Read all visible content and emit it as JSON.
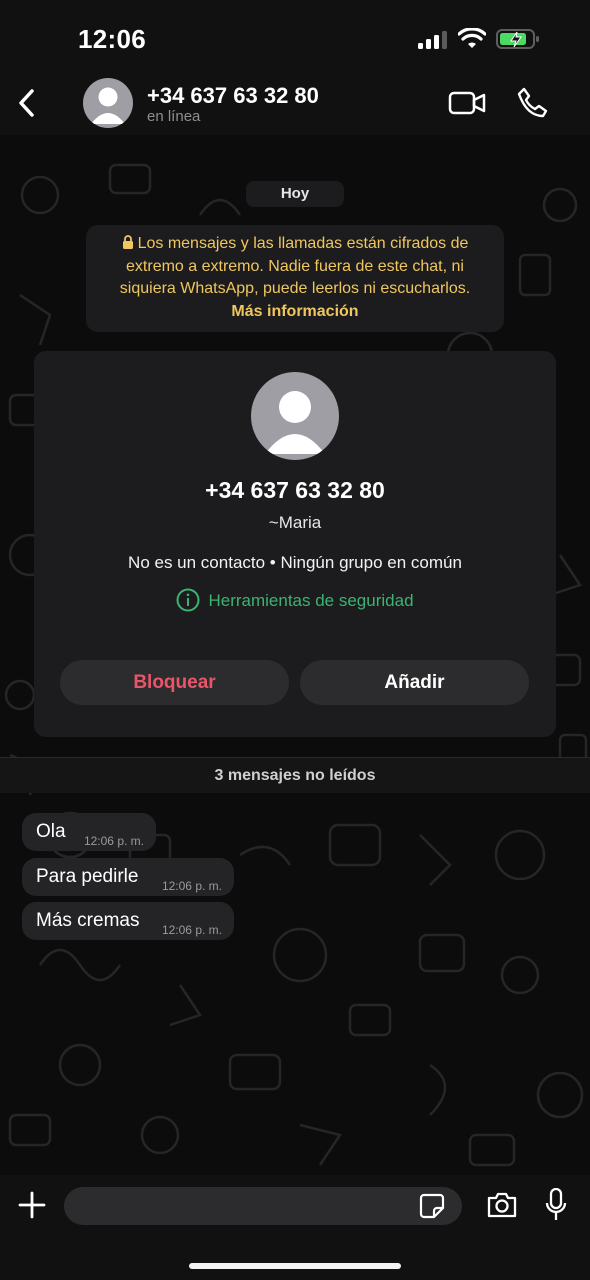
{
  "status_bar": {
    "time": "12:06"
  },
  "header": {
    "contact_number": "+34 637 63 32 80",
    "contact_status": "en línea"
  },
  "chat": {
    "date_label": "Hoy",
    "encryption_notice": "Los mensajes y las llamadas están cifrados de extremo a extremo. Nadie fuera de este chat, ni siquiera WhatsApp, puede leerlos ni escucharlos.",
    "encryption_more": "Más información"
  },
  "contact_card": {
    "number": "+34 637 63 32 80",
    "alias": "~Maria",
    "meta": "No es un contacto • Ningún grupo en común",
    "safety_tools": "Herramientas de seguridad",
    "block_label": "Bloquear",
    "add_label": "Añadir"
  },
  "unread_divider": "3 mensajes no leídos",
  "messages": [
    {
      "text": "Ola",
      "time": "12:06 p. m."
    },
    {
      "text": "Para pedirle",
      "time": "12:06 p. m."
    },
    {
      "text": "Más cremas",
      "time": "12:06 p. m."
    }
  ],
  "composer": {
    "placeholder": ""
  },
  "colors": {
    "accent_green": "#3cb371",
    "notice_yellow": "#f0c75e",
    "block_red": "#e8566a",
    "bubble": "#242426"
  },
  "icons": {
    "back": "chevron-left-icon",
    "video": "video-camera-icon",
    "call": "phone-icon",
    "lock": "lock-icon",
    "info": "info-circle-icon",
    "plus": "plus-icon",
    "sticker": "sticker-icon",
    "camera": "camera-icon",
    "mic": "microphone-icon"
  }
}
